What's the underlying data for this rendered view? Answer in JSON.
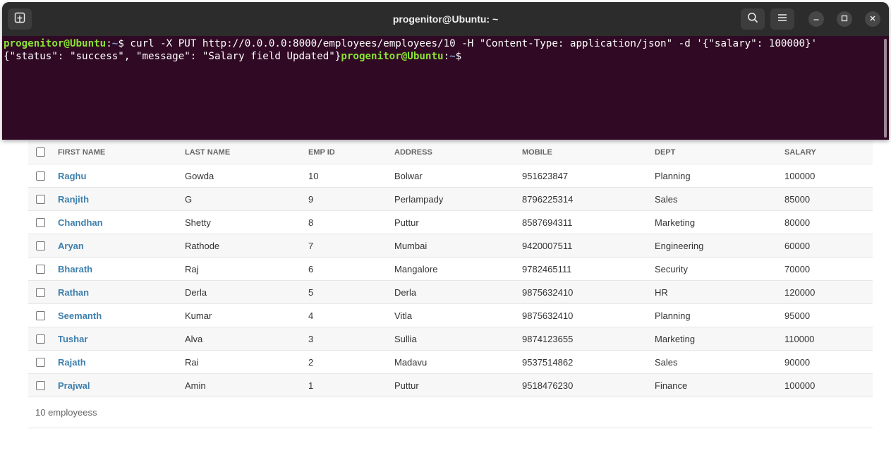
{
  "terminal": {
    "title": "progenitor@Ubuntu: ~",
    "prompt_user": "progenitor@Ubuntu",
    "prompt_sep": ":",
    "prompt_path": "~",
    "prompt_symbol": "$",
    "command": " curl -X PUT http://0.0.0.0:8000/employees/employees/10 -H \"Content-Type: application/json\" -d '{\"salary\": 100000}'",
    "output": "{\"status\": \"success\", \"message\": \"Salary field Updated\"}"
  },
  "table": {
    "headers": [
      "FIRST NAME",
      "LAST NAME",
      "EMP ID",
      "ADDRESS",
      "MOBILE",
      "DEPT",
      "SALARY"
    ],
    "rows": [
      [
        "Raghu",
        "Gowda",
        "10",
        "Bolwar",
        "951623847",
        "Planning",
        "100000"
      ],
      [
        "Ranjith",
        "G",
        "9",
        "Perlampady",
        "8796225314",
        "Sales",
        "85000"
      ],
      [
        "Chandhan",
        "Shetty",
        "8",
        "Puttur",
        "8587694311",
        "Marketing",
        "80000"
      ],
      [
        "Aryan",
        "Rathode",
        "7",
        "Mumbai",
        "9420007511",
        "Engineering",
        "60000"
      ],
      [
        "Bharath",
        "Raj",
        "6",
        "Mangalore",
        "9782465111",
        "Security",
        "70000"
      ],
      [
        "Rathan",
        "Derla",
        "5",
        "Derla",
        "9875632410",
        "HR",
        "120000"
      ],
      [
        "Seemanth",
        "Kumar",
        "4",
        "Vitla",
        "9875632410",
        "Planning",
        "95000"
      ],
      [
        "Tushar",
        "Alva",
        "3",
        "Sullia",
        "9874123655",
        "Marketing",
        "110000"
      ],
      [
        "Rajath",
        "Rai",
        "2",
        "Madavu",
        "9537514862",
        "Sales",
        "90000"
      ],
      [
        "Prajwal",
        "Amin",
        "1",
        "Puttur",
        "9518476230",
        "Finance",
        "100000"
      ]
    ],
    "count_label": "10 employeess"
  },
  "icons": {
    "new_tab": "new-tab-icon",
    "search": "search-icon",
    "menu": "hamburger-menu-icon",
    "minimize": "minimize-icon",
    "maximize": "maximize-icon",
    "close": "close-icon"
  },
  "colors": {
    "terminal_bg": "#300a24",
    "titlebar_bg": "#2c2c2c",
    "prompt_user": "#8ae234",
    "prompt_path": "#729fcf",
    "link": "#3d7fad"
  }
}
